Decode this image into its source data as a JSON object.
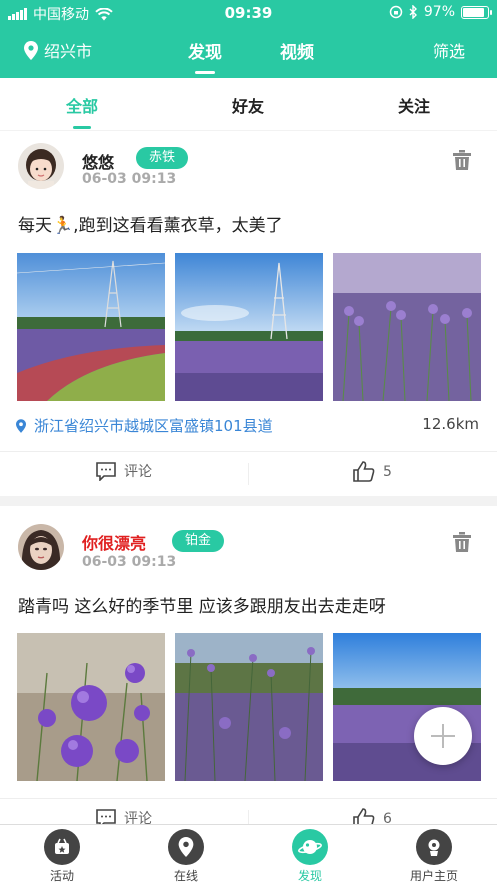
{
  "statusbar": {
    "carrier": "中国移动",
    "time": "09:39",
    "battery": "97%"
  },
  "nav": {
    "location": "绍兴市",
    "tabs": [
      {
        "label": "发现"
      },
      {
        "label": "视频"
      }
    ],
    "filter": "筛选"
  },
  "subtabs": [
    {
      "label": "全部"
    },
    {
      "label": "好友"
    },
    {
      "label": "关注"
    }
  ],
  "posts": [
    {
      "username": "悠悠",
      "badge": "赤铁",
      "time": "06-03 09:13",
      "text_before": "每天",
      "text_emoji": "🏃",
      "text_after": ",跑到这看看薰衣草，太美了",
      "location": "浙江省绍兴市越城区富盛镇101县道",
      "distance": "12.6km",
      "comment_label": "评论",
      "likes": "5"
    },
    {
      "username": "你很漂亮",
      "username_color": "#e02020",
      "badge": "铂金",
      "time": "06-03 09:13",
      "text": "踏青吗 这么好的季节里 应该多跟朋友出去走走呀",
      "comment_label": "评论",
      "likes": "6"
    }
  ],
  "tabbar": [
    {
      "label": "活动",
      "icon": "activity-icon"
    },
    {
      "label": "在线",
      "icon": "map-pin-icon"
    },
    {
      "label": "发现",
      "icon": "planet-icon"
    },
    {
      "label": "用户主页",
      "icon": "user-icon"
    }
  ],
  "colors": {
    "accent": "#29c9a3",
    "link": "#3a86d6",
    "alert_name": "#e02020"
  }
}
